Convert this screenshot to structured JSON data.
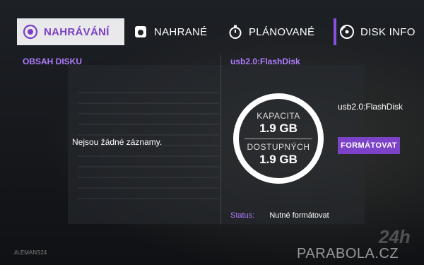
{
  "tabs": [
    {
      "label": "NAHRÁVÁNÍ",
      "icon": "record-icon",
      "active": true
    },
    {
      "label": "NAHRANÉ",
      "icon": "recorded-icon",
      "active": false
    },
    {
      "label": "PLÁNOVANÉ",
      "icon": "stopwatch-icon",
      "active": false
    },
    {
      "label": "DISK INFO",
      "icon": "disk-icon",
      "active": false
    }
  ],
  "left_panel": {
    "title": "OBSAH DISKU",
    "empty_message": "Nejsou žádné záznamy."
  },
  "right_panel": {
    "title": "usb2.0:FlashDisk",
    "disk_name": "usb2.0:FlashDisk",
    "capacity_label": "KAPACITA",
    "capacity_value": "1.9 GB",
    "available_label": "DOSTUPNÝCH",
    "available_value": "1.9 GB",
    "format_button": "FORMÁTOVAT",
    "status_label": "Status:",
    "status_value": "Nutné formátovat"
  },
  "overlay": {
    "hashtag": "#LEMANS24",
    "watermark": "PARABOLA.CZ",
    "logo_text": "24h"
  },
  "colors": {
    "accent": "#7c42c8",
    "accent_text": "#b07cff",
    "active_tab_bg": "#e9e9ec"
  }
}
